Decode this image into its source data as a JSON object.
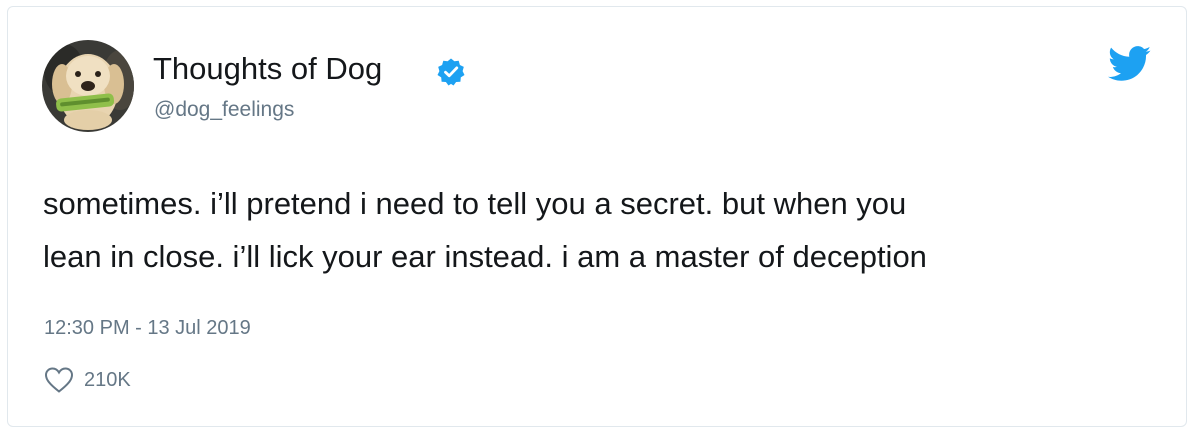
{
  "tweet": {
    "display_name": "Thoughts of Dog",
    "handle": "@dog_feelings",
    "verified": true,
    "avatar_icon": "labrador-puppy-avatar",
    "text_lines": [
      "sometimes. i’ll pretend i need to tell you a secret. but when you",
      "lean in close. i’ll lick your ear instead. i am a master of deception"
    ],
    "timestamp": "12:30 PM - 13 Jul 2019",
    "likes": "210K"
  },
  "icons": {
    "brand": "twitter-bird-icon",
    "badge": "verified-badge-icon",
    "like": "heart-icon"
  },
  "colors": {
    "twitter_blue": "#1da1f2",
    "text_primary": "#14171a",
    "text_secondary": "#657786",
    "border": "#e1e8ed"
  }
}
